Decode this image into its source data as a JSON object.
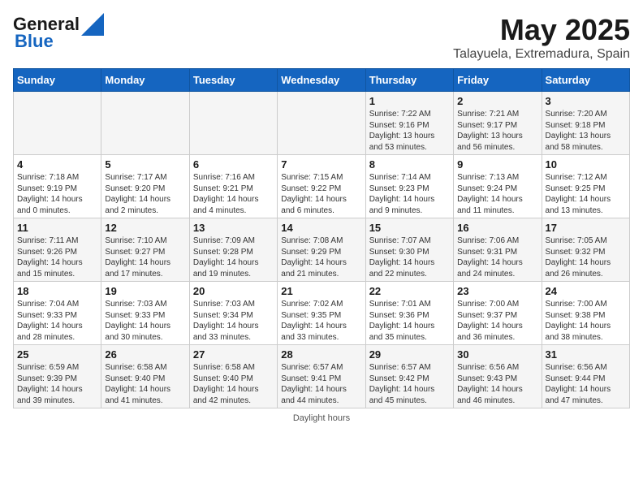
{
  "header": {
    "logo_line1": "General",
    "logo_line2": "Blue",
    "title": "May 2025",
    "subtitle": "Talayuela, Extremadura, Spain"
  },
  "weekdays": [
    "Sunday",
    "Monday",
    "Tuesday",
    "Wednesday",
    "Thursday",
    "Friday",
    "Saturday"
  ],
  "weeks": [
    [
      {
        "day": "",
        "info": ""
      },
      {
        "day": "",
        "info": ""
      },
      {
        "day": "",
        "info": ""
      },
      {
        "day": "",
        "info": ""
      },
      {
        "day": "1",
        "info": "Sunrise: 7:22 AM\nSunset: 9:16 PM\nDaylight: 13 hours\nand 53 minutes."
      },
      {
        "day": "2",
        "info": "Sunrise: 7:21 AM\nSunset: 9:17 PM\nDaylight: 13 hours\nand 56 minutes."
      },
      {
        "day": "3",
        "info": "Sunrise: 7:20 AM\nSunset: 9:18 PM\nDaylight: 13 hours\nand 58 minutes."
      }
    ],
    [
      {
        "day": "4",
        "info": "Sunrise: 7:18 AM\nSunset: 9:19 PM\nDaylight: 14 hours\nand 0 minutes."
      },
      {
        "day": "5",
        "info": "Sunrise: 7:17 AM\nSunset: 9:20 PM\nDaylight: 14 hours\nand 2 minutes."
      },
      {
        "day": "6",
        "info": "Sunrise: 7:16 AM\nSunset: 9:21 PM\nDaylight: 14 hours\nand 4 minutes."
      },
      {
        "day": "7",
        "info": "Sunrise: 7:15 AM\nSunset: 9:22 PM\nDaylight: 14 hours\nand 6 minutes."
      },
      {
        "day": "8",
        "info": "Sunrise: 7:14 AM\nSunset: 9:23 PM\nDaylight: 14 hours\nand 9 minutes."
      },
      {
        "day": "9",
        "info": "Sunrise: 7:13 AM\nSunset: 9:24 PM\nDaylight: 14 hours\nand 11 minutes."
      },
      {
        "day": "10",
        "info": "Sunrise: 7:12 AM\nSunset: 9:25 PM\nDaylight: 14 hours\nand 13 minutes."
      }
    ],
    [
      {
        "day": "11",
        "info": "Sunrise: 7:11 AM\nSunset: 9:26 PM\nDaylight: 14 hours\nand 15 minutes."
      },
      {
        "day": "12",
        "info": "Sunrise: 7:10 AM\nSunset: 9:27 PM\nDaylight: 14 hours\nand 17 minutes."
      },
      {
        "day": "13",
        "info": "Sunrise: 7:09 AM\nSunset: 9:28 PM\nDaylight: 14 hours\nand 19 minutes."
      },
      {
        "day": "14",
        "info": "Sunrise: 7:08 AM\nSunset: 9:29 PM\nDaylight: 14 hours\nand 21 minutes."
      },
      {
        "day": "15",
        "info": "Sunrise: 7:07 AM\nSunset: 9:30 PM\nDaylight: 14 hours\nand 22 minutes."
      },
      {
        "day": "16",
        "info": "Sunrise: 7:06 AM\nSunset: 9:31 PM\nDaylight: 14 hours\nand 24 minutes."
      },
      {
        "day": "17",
        "info": "Sunrise: 7:05 AM\nSunset: 9:32 PM\nDaylight: 14 hours\nand 26 minutes."
      }
    ],
    [
      {
        "day": "18",
        "info": "Sunrise: 7:04 AM\nSunset: 9:33 PM\nDaylight: 14 hours\nand 28 minutes."
      },
      {
        "day": "19",
        "info": "Sunrise: 7:03 AM\nSunset: 9:33 PM\nDaylight: 14 hours\nand 30 minutes."
      },
      {
        "day": "20",
        "info": "Sunrise: 7:03 AM\nSunset: 9:34 PM\nDaylight: 14 hours\nand 33 minutes."
      },
      {
        "day": "21",
        "info": "Sunrise: 7:02 AM\nSunset: 9:35 PM\nDaylight: 14 hours\nand 33 minutes."
      },
      {
        "day": "22",
        "info": "Sunrise: 7:01 AM\nSunset: 9:36 PM\nDaylight: 14 hours\nand 35 minutes."
      },
      {
        "day": "23",
        "info": "Sunrise: 7:00 AM\nSunset: 9:37 PM\nDaylight: 14 hours\nand 36 minutes."
      },
      {
        "day": "24",
        "info": "Sunrise: 7:00 AM\nSunset: 9:38 PM\nDaylight: 14 hours\nand 38 minutes."
      }
    ],
    [
      {
        "day": "25",
        "info": "Sunrise: 6:59 AM\nSunset: 9:39 PM\nDaylight: 14 hours\nand 39 minutes."
      },
      {
        "day": "26",
        "info": "Sunrise: 6:58 AM\nSunset: 9:40 PM\nDaylight: 14 hours\nand 41 minutes."
      },
      {
        "day": "27",
        "info": "Sunrise: 6:58 AM\nSunset: 9:40 PM\nDaylight: 14 hours\nand 42 minutes."
      },
      {
        "day": "28",
        "info": "Sunrise: 6:57 AM\nSunset: 9:41 PM\nDaylight: 14 hours\nand 44 minutes."
      },
      {
        "day": "29",
        "info": "Sunrise: 6:57 AM\nSunset: 9:42 PM\nDaylight: 14 hours\nand 45 minutes."
      },
      {
        "day": "30",
        "info": "Sunrise: 6:56 AM\nSunset: 9:43 PM\nDaylight: 14 hours\nand 46 minutes."
      },
      {
        "day": "31",
        "info": "Sunrise: 6:56 AM\nSunset: 9:44 PM\nDaylight: 14 hours\nand 47 minutes."
      }
    ]
  ],
  "footer": {
    "label": "Daylight hours"
  }
}
